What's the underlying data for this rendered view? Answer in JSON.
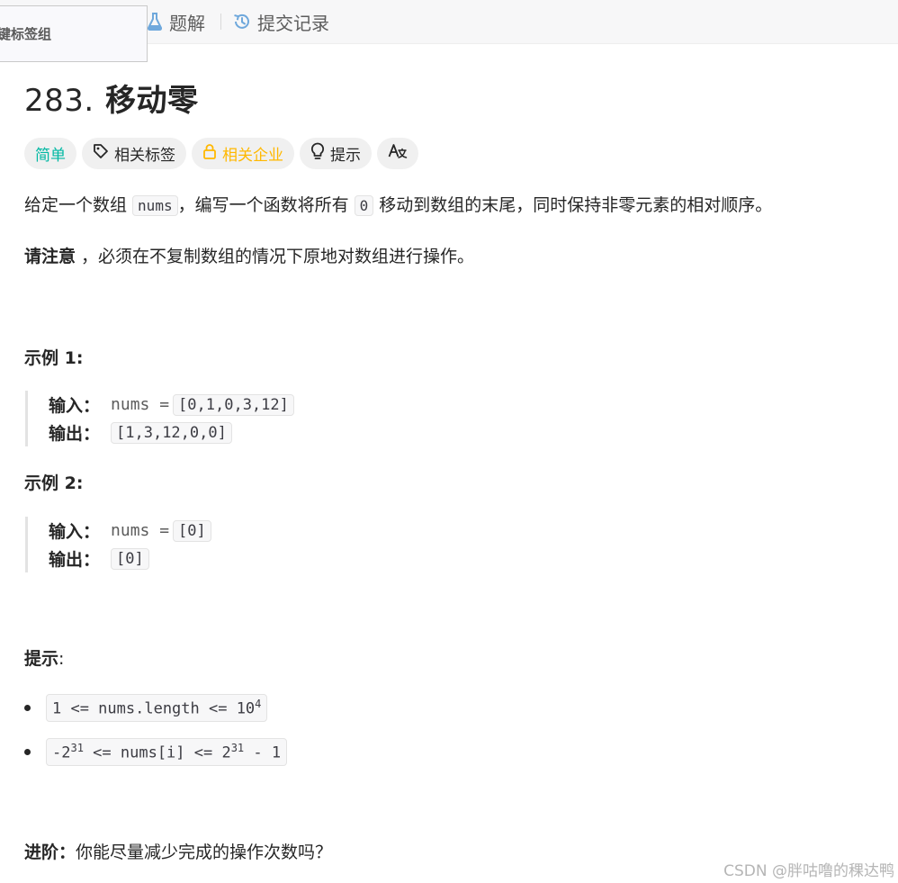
{
  "popup": {
    "label": "键标签组"
  },
  "tabs": [
    {
      "label": "题解",
      "icon": "flask-icon"
    },
    {
      "label": "提交记录",
      "icon": "history-icon"
    }
  ],
  "problem": {
    "number": "283.",
    "name": "移动零",
    "tags": {
      "difficulty": "简单",
      "related_tags": "相关标签",
      "related_companies": "相关企业",
      "hint": "提示"
    },
    "description": {
      "p1_before": "给定一个数组 ",
      "p1_code1": "nums",
      "p1_middle": "，编写一个函数将所有 ",
      "p1_code2": "0",
      "p1_after": " 移动到数组的末尾，同时保持非零元素的相对顺序。",
      "note_bold": "请注意",
      "note_rest": " ，必须在不复制数组的情况下原地对数组进行操作。"
    },
    "examples": [
      {
        "title": "示例 1:",
        "input_label": "输入：",
        "input_var": "nums = ",
        "input_value": "[0,1,0,3,12]",
        "output_label": "输出：",
        "output_value": "[1,3,12,0,0]"
      },
      {
        "title": "示例 2:",
        "input_label": "输入：",
        "input_var": "nums = ",
        "input_value": "[0]",
        "output_label": "输出：",
        "output_value": "[0]"
      }
    ],
    "hints_title": "提示",
    "hints_colon": ":",
    "constraints": [
      {
        "main": "1 <= nums.length <= 10",
        "sup": "4",
        "tail": ""
      },
      {
        "main": "-2",
        "sup": "31",
        "mid": " <= nums[i] <= 2",
        "sup2": "31",
        "tail": " - 1"
      }
    ],
    "advanced_bold": "进阶：",
    "advanced_text": "你能尽量减少完成的操作次数吗？"
  },
  "watermark": "CSDN @胖咕噜的稞达鸭",
  "colors": {
    "easy": "#00b8a3",
    "company": "#ffb800",
    "tab_icon": "#6fa8dc"
  }
}
